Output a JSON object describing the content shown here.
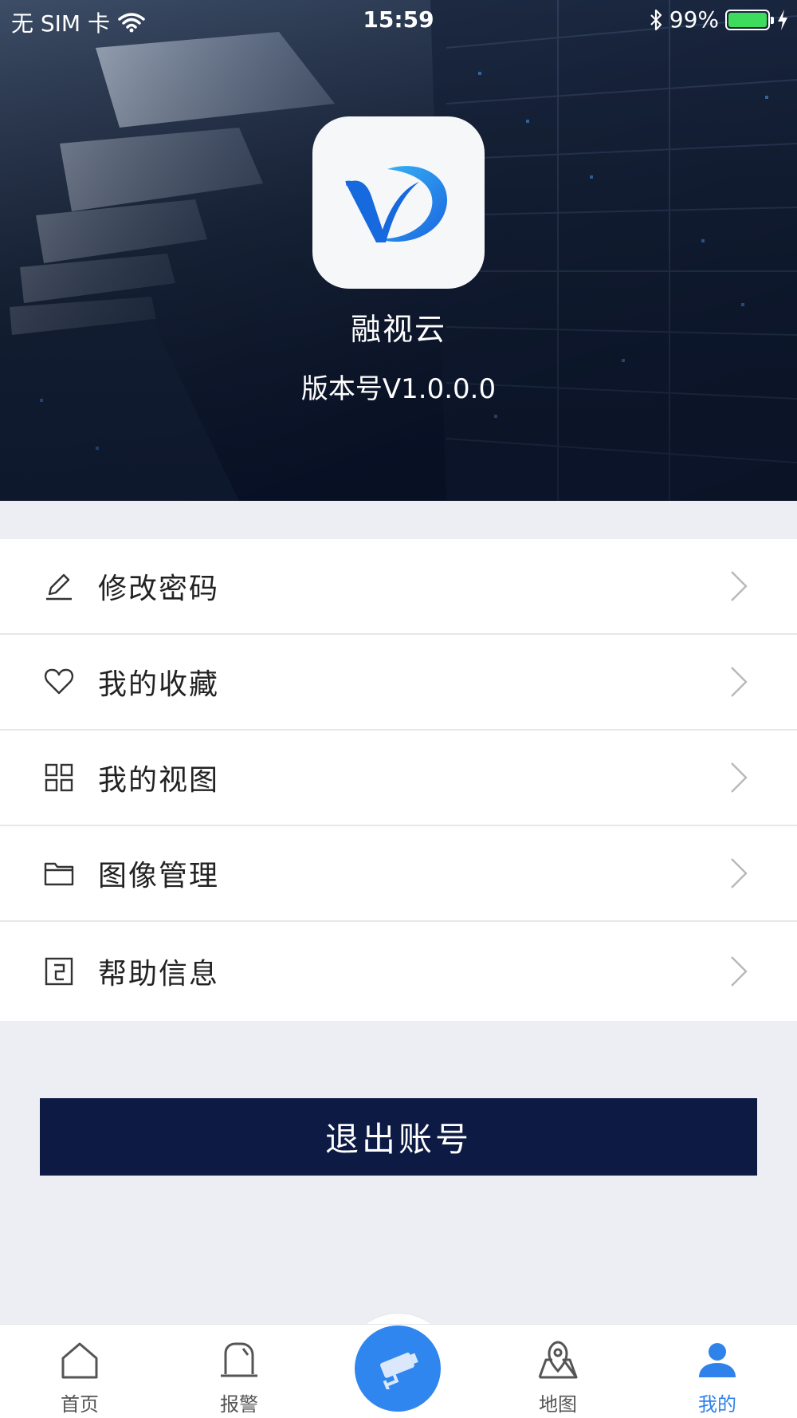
{
  "status_bar": {
    "carrier": "无 SIM 卡",
    "time": "15:59",
    "battery": "99%",
    "battery_level": 0.99
  },
  "app": {
    "name": "融视云",
    "version": "版本号V1.0.0.0"
  },
  "menu": {
    "items": [
      {
        "label": "修改密码",
        "icon": "pencil-icon"
      },
      {
        "label": "我的收藏",
        "icon": "heart-icon"
      },
      {
        "label": "我的视图",
        "icon": "grid-icon"
      },
      {
        "label": "图像管理",
        "icon": "folder-icon"
      },
      {
        "label": "帮助信息",
        "icon": "help-icon"
      }
    ]
  },
  "logout_label": "退出账号",
  "tabbar": {
    "items": [
      {
        "label": "首页",
        "icon": "home-icon"
      },
      {
        "label": "报警",
        "icon": "alarm-icon"
      },
      {
        "label": "",
        "icon": "camera-icon"
      },
      {
        "label": "地图",
        "icon": "map-icon"
      },
      {
        "label": "我的",
        "icon": "user-icon",
        "active": true
      }
    ]
  },
  "colors": {
    "accent": "#2f82ea",
    "logout_bg": "#0c1a44",
    "page_bg": "#eceef3"
  }
}
